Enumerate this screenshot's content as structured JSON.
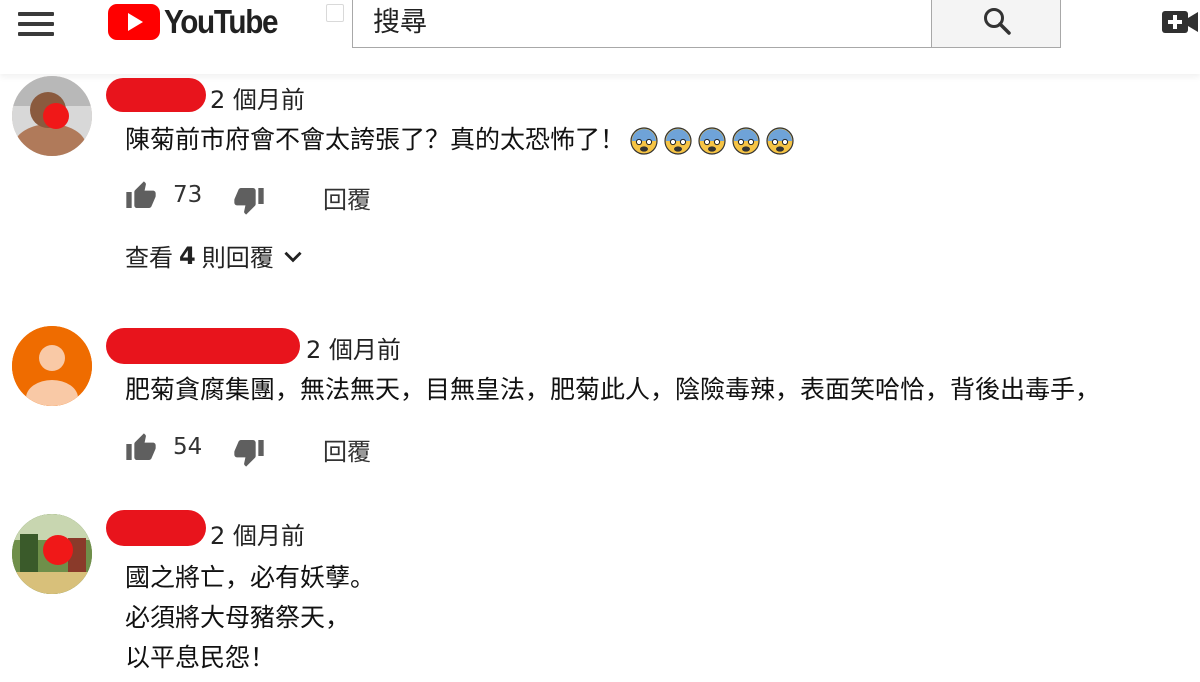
{
  "header": {
    "logo_text": "YouTube",
    "search_placeholder": "搜尋",
    "icons": {
      "menu": "hamburger-menu-icon",
      "search": "search-icon",
      "create": "video-add-icon"
    },
    "brand_color": "#ff0000"
  },
  "comments": [
    {
      "time": "2 個月前",
      "text": "陳菊前市府會不會太誇張了？真的太恐怖了！",
      "emoji": [
        "😨",
        "😨",
        "😨",
        "😨",
        "😨"
      ],
      "likes": "73",
      "reply_label": "回覆",
      "view_replies": {
        "prefix": "查看",
        "count": "4",
        "suffix": "則回覆"
      }
    },
    {
      "time": "2 個月前",
      "text": "肥菊貪腐集團，無法無天，目無皇法，肥菊此人，陰險毒辣，表面笑哈恰，背後出毒手，",
      "likes": "54",
      "reply_label": "回覆"
    },
    {
      "time": "2 個月前",
      "lines": [
        "國之將亡，必有妖孽。",
        "必須將大母豬祭天，",
        "以平息民怨！"
      ]
    }
  ],
  "colors": {
    "redaction": "#e8141c",
    "default_avatar_bg": "#ef6c00",
    "default_avatar_fg": "#f9c9a6"
  }
}
